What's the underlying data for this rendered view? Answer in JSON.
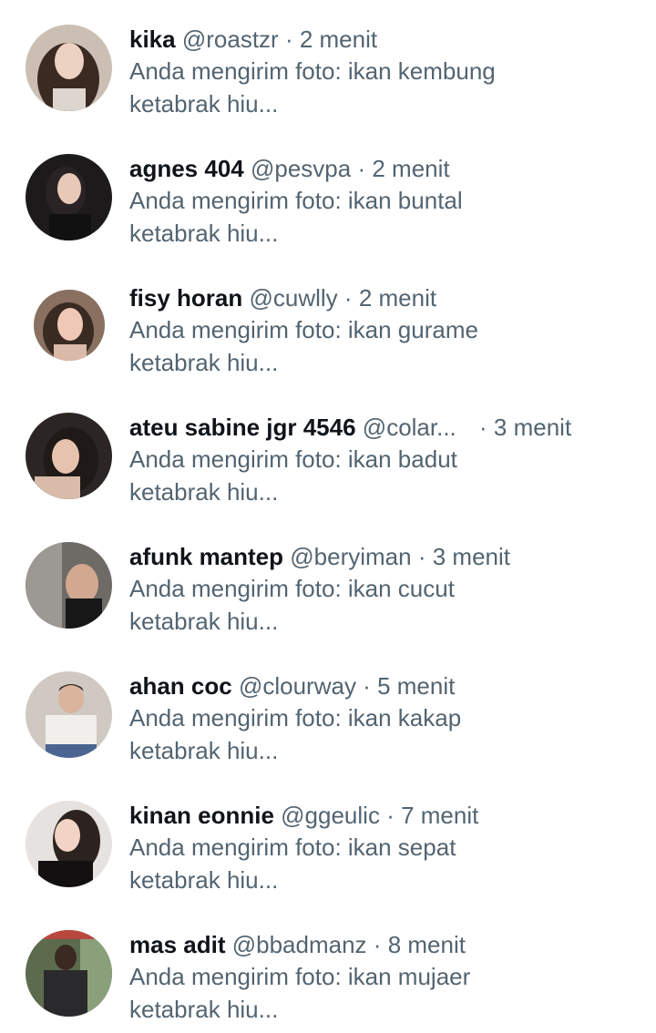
{
  "conversations": [
    {
      "name": "kika",
      "handle": "@roastzr",
      "separator": "·",
      "time": "2 menit",
      "preview_line1": "Anda mengirim foto: ikan kembung",
      "preview_line2": "ketabrak hiu...",
      "avatar": "avatar-photo"
    },
    {
      "name": "agnes 404",
      "handle": "@pesvpa",
      "separator": "·",
      "time": "2 menit",
      "preview_line1": "Anda mengirim foto: ikan buntal",
      "preview_line2": "ketabrak hiu...",
      "avatar": "avatar-photo"
    },
    {
      "name": "fisy horan",
      "handle": "@cuwlly",
      "separator": "·",
      "time": "2 menit",
      "preview_line1": "Anda mengirim foto: ikan gurame",
      "preview_line2": "ketabrak hiu...",
      "avatar": "avatar-photo"
    },
    {
      "name": "ateu sabine jgr 4546",
      "handle": "@colar...",
      "separator": "·",
      "time": "3 menit",
      "preview_line1": "Anda mengirim foto: ikan badut",
      "preview_line2": "ketabrak hiu...",
      "avatar": "avatar-photo"
    },
    {
      "name": "afunk mantep",
      "handle": "@beryiman",
      "separator": "·",
      "time": "3 menit",
      "preview_line1": "Anda mengirim foto: ikan cucut",
      "preview_line2": "ketabrak hiu...",
      "avatar": "avatar-photo"
    },
    {
      "name": "ahan coc",
      "handle": "@clourway",
      "separator": "·",
      "time": "5 menit",
      "preview_line1": "Anda mengirim foto: ikan kakap",
      "preview_line2": "ketabrak hiu...",
      "avatar": "avatar-photo"
    },
    {
      "name": "kinan eonnie",
      "handle": "@ggeulic",
      "separator": "·",
      "time": "7 menit",
      "preview_line1": "Anda mengirim foto: ikan sepat",
      "preview_line2": "ketabrak hiu...",
      "avatar": "avatar-photo"
    },
    {
      "name": "mas adit",
      "handle": "@bbadmanz",
      "separator": "·",
      "time": "8 menit",
      "preview_line1": "Anda mengirim foto: ikan mujaer",
      "preview_line2": "ketabrak hiu...",
      "avatar": "avatar-photo"
    }
  ],
  "colors": {
    "name_text": "#0f1419",
    "secondary_text": "#536471",
    "background": "#ffffff"
  }
}
